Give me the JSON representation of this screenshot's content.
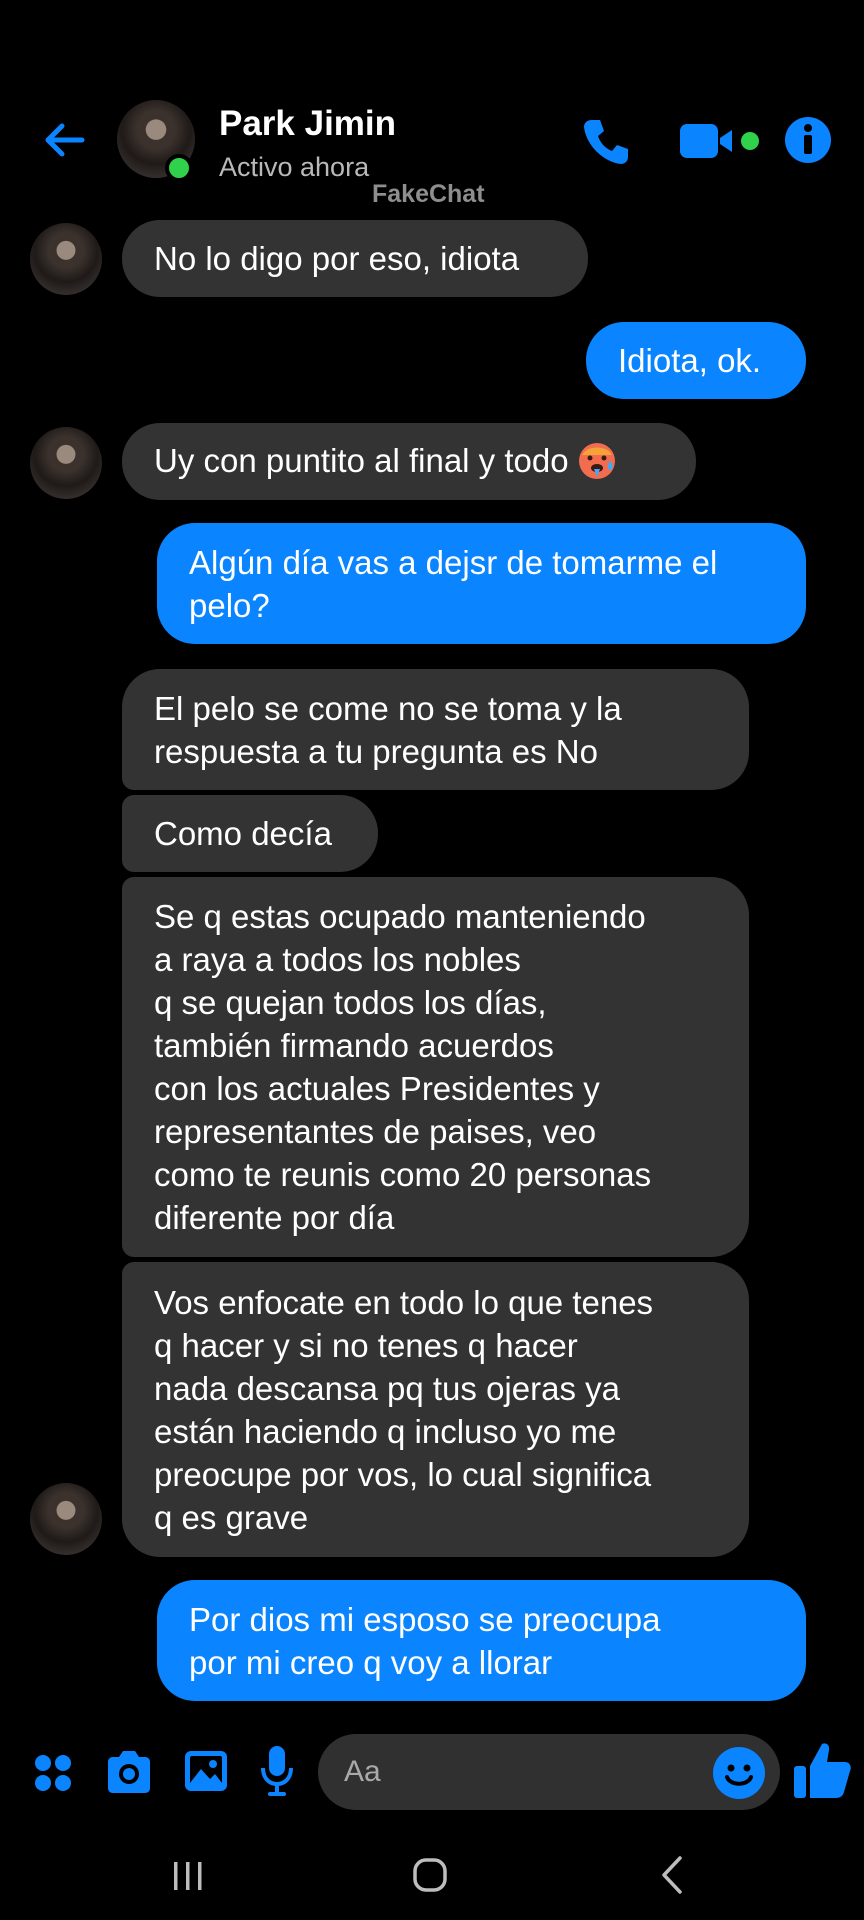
{
  "header": {
    "contact_name": "Park Jimin",
    "status": "Activo ahora",
    "watermark": "FakeChat"
  },
  "messages": [
    {
      "direction": "in",
      "text": "No lo digo por eso, idiota"
    },
    {
      "direction": "out",
      "text": "Idiota, ok."
    },
    {
      "direction": "in",
      "text": "Uy con puntito al final y todo",
      "emoji": "hot-face-emoji"
    },
    {
      "direction": "out",
      "text": "Algún día vas a dejsr de tomarme el\npelo?"
    },
    {
      "direction": "in",
      "text": "El pelo se come no se toma y la\nrespuesta a tu pregunta es No"
    },
    {
      "direction": "in",
      "text": "Como decía"
    },
    {
      "direction": "in",
      "text": "Se q estas ocupado manteniendo\na raya a todos los nobles\nq se quejan todos los días,\ntambién firmando acuerdos\ncon los actuales Presidentes y\nrepresentantes de paises, veo\ncomo te reunis como 20 personas\ndiferente por día"
    },
    {
      "direction": "in",
      "text": "Vos enfocate en todo lo que tenes\nq hacer y si no tenes q hacer\nnada descansa pq tus ojeras ya\nestán haciendo q incluso yo me\npreocupe por vos, lo cual significa\nq es grave"
    },
    {
      "direction": "out",
      "text": "Por dios mi esposo se preocupa\npor mi creo q voy a llorar"
    }
  ],
  "composer": {
    "placeholder": "Aa",
    "icons": [
      "apps-icon",
      "camera-icon",
      "gallery-icon",
      "microphone-icon",
      "emoji-icon",
      "thumbs-up-icon"
    ]
  },
  "colors": {
    "accent": "#0a84ff",
    "incoming_bubble": "#333333",
    "online": "#2fd24a",
    "background": "#000000"
  }
}
